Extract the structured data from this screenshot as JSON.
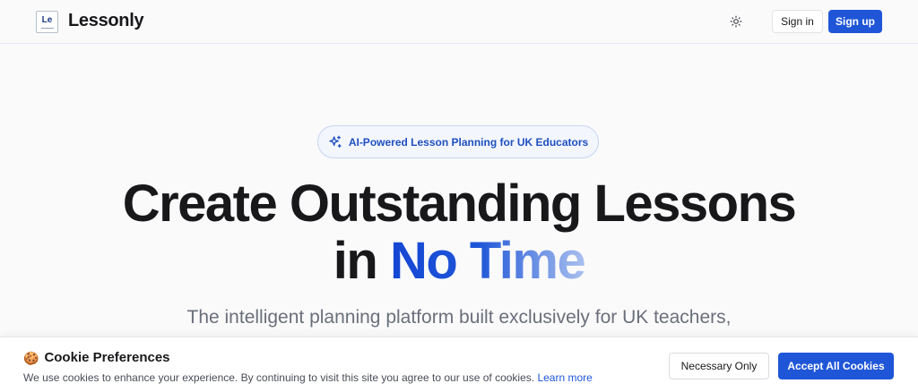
{
  "header": {
    "logo_mark": "Le",
    "brand": "Lessonly",
    "theme_icon": "sun-icon",
    "signin_label": "Sign in",
    "signup_label": "Sign up"
  },
  "hero": {
    "badge_icon": "sparkles-icon",
    "badge_text": "AI-Powered Lesson Planning for UK Educators",
    "headline_line1": "Create Outstanding Lessons",
    "headline_line2_prefix": "in ",
    "headline_highlight": "No Time",
    "subtitle": "The intelligent planning platform built exclusively for UK teachers,"
  },
  "cookie": {
    "emoji": "🍪",
    "title": "Cookie Preferences",
    "text": "We use cookies to enhance your experience. By continuing to visit this site you agree to our use of cookies.",
    "link_label": "Learn more",
    "necessary_label": "Necessary Only",
    "accept_label": "Accept All Cookies"
  },
  "colors": {
    "accent": "#1f56d8",
    "badge_text": "#1f4fbf",
    "background": "#fafafb"
  }
}
